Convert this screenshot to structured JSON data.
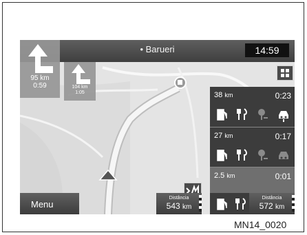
{
  "header": {
    "city": "Barueri",
    "clock": "14:59"
  },
  "turn_main": {
    "km": "95 km",
    "time": "0:59"
  },
  "turn_next": {
    "km": "104 km",
    "time": "1:05"
  },
  "poi_panel": {
    "rows": [
      {
        "km": "38",
        "unit": "km",
        "time": "0:23"
      },
      {
        "km": "27",
        "unit": "km",
        "time": "0:17"
      },
      {
        "km": "2.5",
        "unit": "km",
        "time": "0:01"
      }
    ],
    "icons": [
      "fuel-icon",
      "restaurant-icon",
      "parking-icon",
      "car-service-icon"
    ]
  },
  "bottom": {
    "menu_label": "Menu",
    "distance_left": {
      "label": "Distância",
      "value": "543",
      "unit": "km"
    },
    "distance_right": {
      "label": "Distância",
      "value": "572",
      "unit": "km"
    }
  },
  "caption": "MN14_0020",
  "colors": {
    "bar": "#4a4a4a",
    "panel": "#3c3c3c",
    "map": "#e6e6e6",
    "route": "#f2f2f2"
  }
}
